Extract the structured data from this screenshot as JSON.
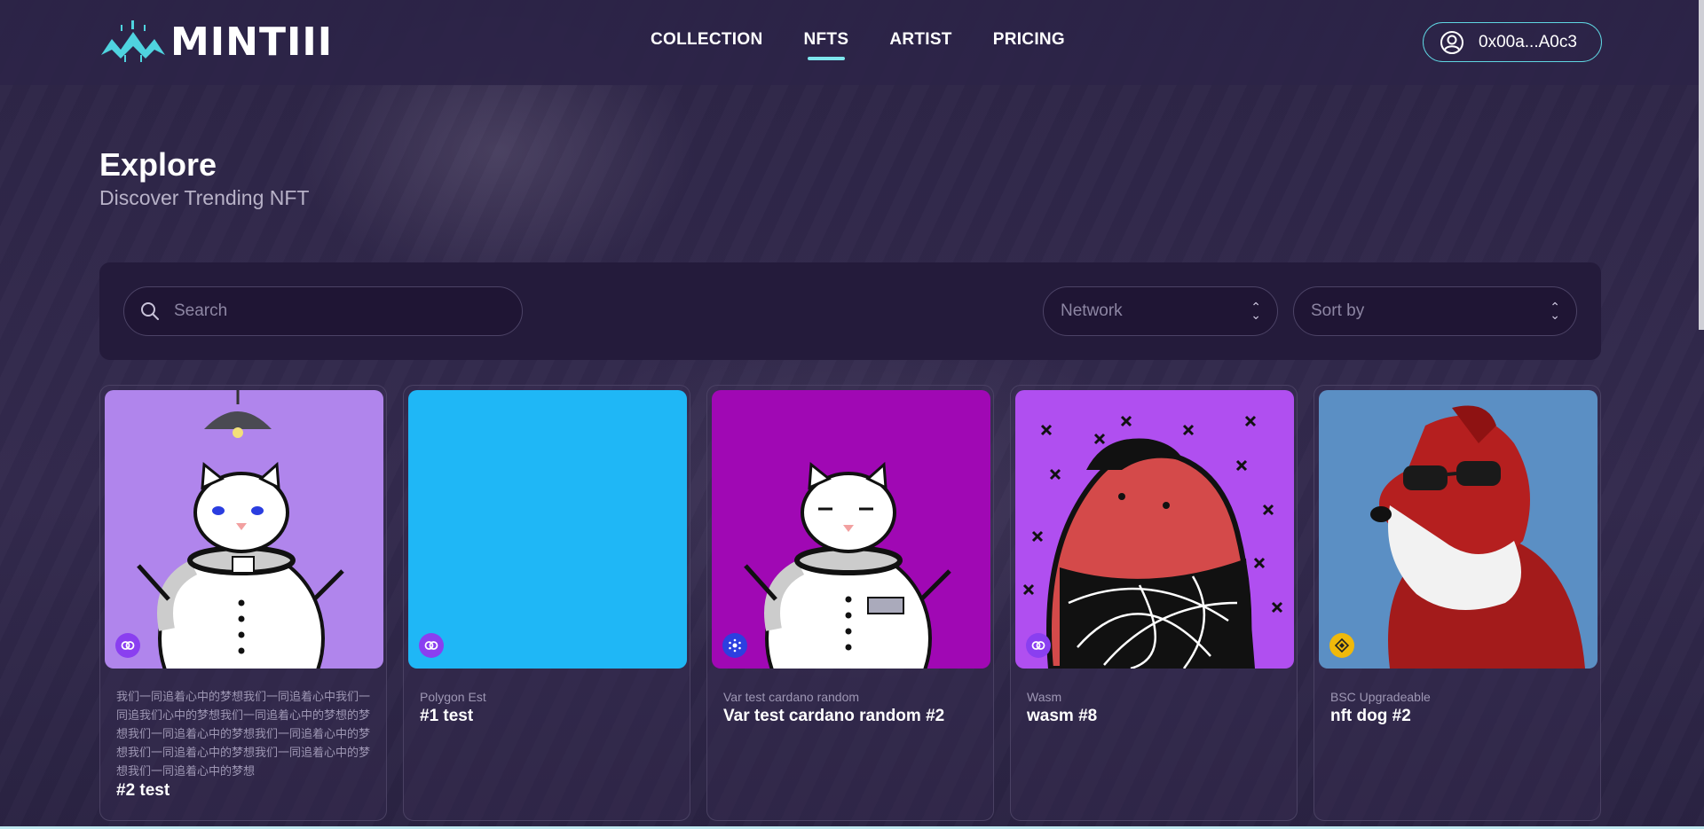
{
  "header": {
    "logo_text": "MINTIII",
    "nav": [
      {
        "label": "COLLECTION",
        "active": false
      },
      {
        "label": "NFTS",
        "active": true
      },
      {
        "label": "ARTIST",
        "active": false
      },
      {
        "label": "PRICING",
        "active": false
      }
    ],
    "wallet_address": "0x00a...A0c3",
    "accent_color": "#7ee6ee"
  },
  "page": {
    "title": "Explore",
    "subtitle": "Discover Trending NFT"
  },
  "filters": {
    "search_placeholder": "Search",
    "network_placeholder": "Network",
    "sort_placeholder": "Sort by"
  },
  "cards": [
    {
      "collection": "我们一同追着心中的梦想我们一同追着心中我们一同追我们心中的梦想我们一同追着心中的梦想的梦想我们一同追着心中的梦想我们一同追着心中的梦想我们一同追着心中的梦想我们一同追着心中的梦想我们一同追着心中的梦想",
      "name": "#2 test",
      "chain_icon": "polygon-icon",
      "image": "cat-astronaut-lamp"
    },
    {
      "collection": "Polygon Est",
      "name": "#1 test",
      "chain_icon": "polygon-icon",
      "image": "solid-blue"
    },
    {
      "collection": "Var test cardano random",
      "name": "Var test cardano random #2",
      "chain_icon": "cardano-icon",
      "image": "cat-astronaut-magenta"
    },
    {
      "collection": "Wasm",
      "name": "wasm #8",
      "chain_icon": "polygon-icon",
      "image": "red-creature"
    },
    {
      "collection": "BSC Upgradeable",
      "name": "nft dog #2",
      "chain_icon": "bnb-icon",
      "image": "red-dog"
    }
  ]
}
